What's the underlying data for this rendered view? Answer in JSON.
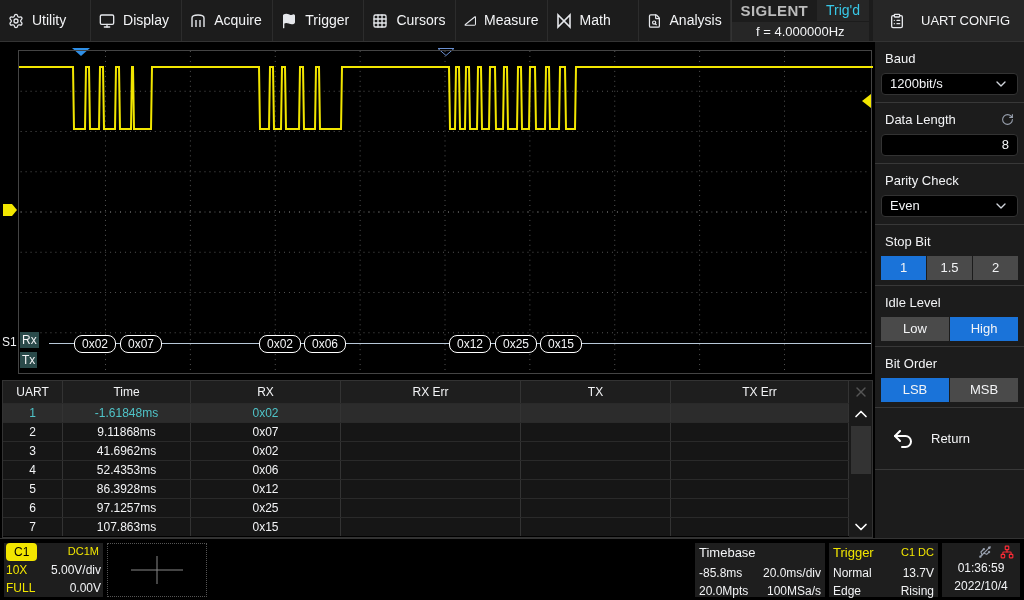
{
  "menu": [
    {
      "kind": "gear",
      "label": "Utility"
    },
    {
      "kind": "monitor",
      "label": "Display"
    },
    {
      "kind": "acquire",
      "label": "Acquire"
    },
    {
      "kind": "flag",
      "label": "Trigger"
    },
    {
      "kind": "cursors",
      "label": "Cursors"
    },
    {
      "kind": "ruler",
      "label": "Measure"
    },
    {
      "kind": "math",
      "label": "Math"
    },
    {
      "kind": "analysis",
      "label": "Analysis"
    }
  ],
  "brand": "SIGLENT",
  "trigger_status": "Trig'd",
  "frequency": "f = 4.000000Hz",
  "decode": {
    "bus": "S1",
    "lanes": [
      {
        "label": "Rx",
        "frames": [
          "0x02",
          "0x07",
          "0x02",
          "0x06",
          "0x12",
          "0x25",
          "0x15"
        ]
      },
      {
        "label": "Tx"
      }
    ]
  },
  "table": {
    "columns": [
      "UART",
      "Time",
      "RX",
      "RX Err",
      "TX",
      "TX Err"
    ],
    "rows": [
      {
        "selected": true,
        "cells": [
          "1",
          "-1.61848ms",
          "0x02"
        ]
      },
      {
        "selected": false,
        "cells": [
          "2",
          "9.11868ms",
          "0x07"
        ]
      },
      {
        "selected": false,
        "cells": [
          "3",
          "41.6962ms",
          "0x02"
        ]
      },
      {
        "selected": false,
        "cells": [
          "4",
          "52.4353ms",
          "0x06"
        ]
      },
      {
        "selected": false,
        "cells": [
          "5",
          "86.3928ms",
          "0x12"
        ]
      },
      {
        "selected": false,
        "cells": [
          "6",
          "97.1257ms",
          "0x25"
        ]
      },
      {
        "selected": false,
        "cells": [
          "7",
          "107.863ms",
          "0x15"
        ]
      }
    ]
  },
  "panel": {
    "title": "UART CONFIG",
    "settings": [
      {
        "kind": "select",
        "label": "Baud",
        "value": "1200bit/s"
      },
      {
        "kind": "number",
        "label": "Data Length",
        "value": "8"
      },
      {
        "kind": "select",
        "label": "Parity Check",
        "value": "Even"
      },
      {
        "kind": "segmented",
        "label": "Stop Bit",
        "options": [
          {
            "label": "1",
            "selected": true
          },
          {
            "label": "1.5",
            "selected": false
          },
          {
            "label": "2",
            "selected": false
          }
        ]
      },
      {
        "kind": "segmented",
        "label": "Idle Level",
        "options": [
          {
            "label": "Low",
            "selected": false
          },
          {
            "label": "High",
            "selected": true
          }
        ]
      },
      {
        "kind": "segmented",
        "label": "Bit Order",
        "options": [
          {
            "label": "LSB",
            "selected": true
          },
          {
            "label": "MSB",
            "selected": false
          }
        ]
      }
    ],
    "return": "Return"
  },
  "channel": {
    "name": "C1",
    "coupling": "DC1M",
    "probe": "10X",
    "scale": "5.00V/div",
    "bandwidth": "FULL",
    "offset": "0.00V"
  },
  "timebase": {
    "title": "Timebase",
    "delay": "-85.8ms",
    "scale": "20.0ms/div",
    "memory": "20.0Mpts",
    "sample_rate": "100MSa/s"
  },
  "trigger": {
    "title": "Trigger",
    "source": "C1 DC",
    "mode": "Normal",
    "level": "13.7V",
    "type": "Edge",
    "slope": "Rising"
  },
  "clock": {
    "time": "01:36:59",
    "date": "2022/10/4"
  }
}
